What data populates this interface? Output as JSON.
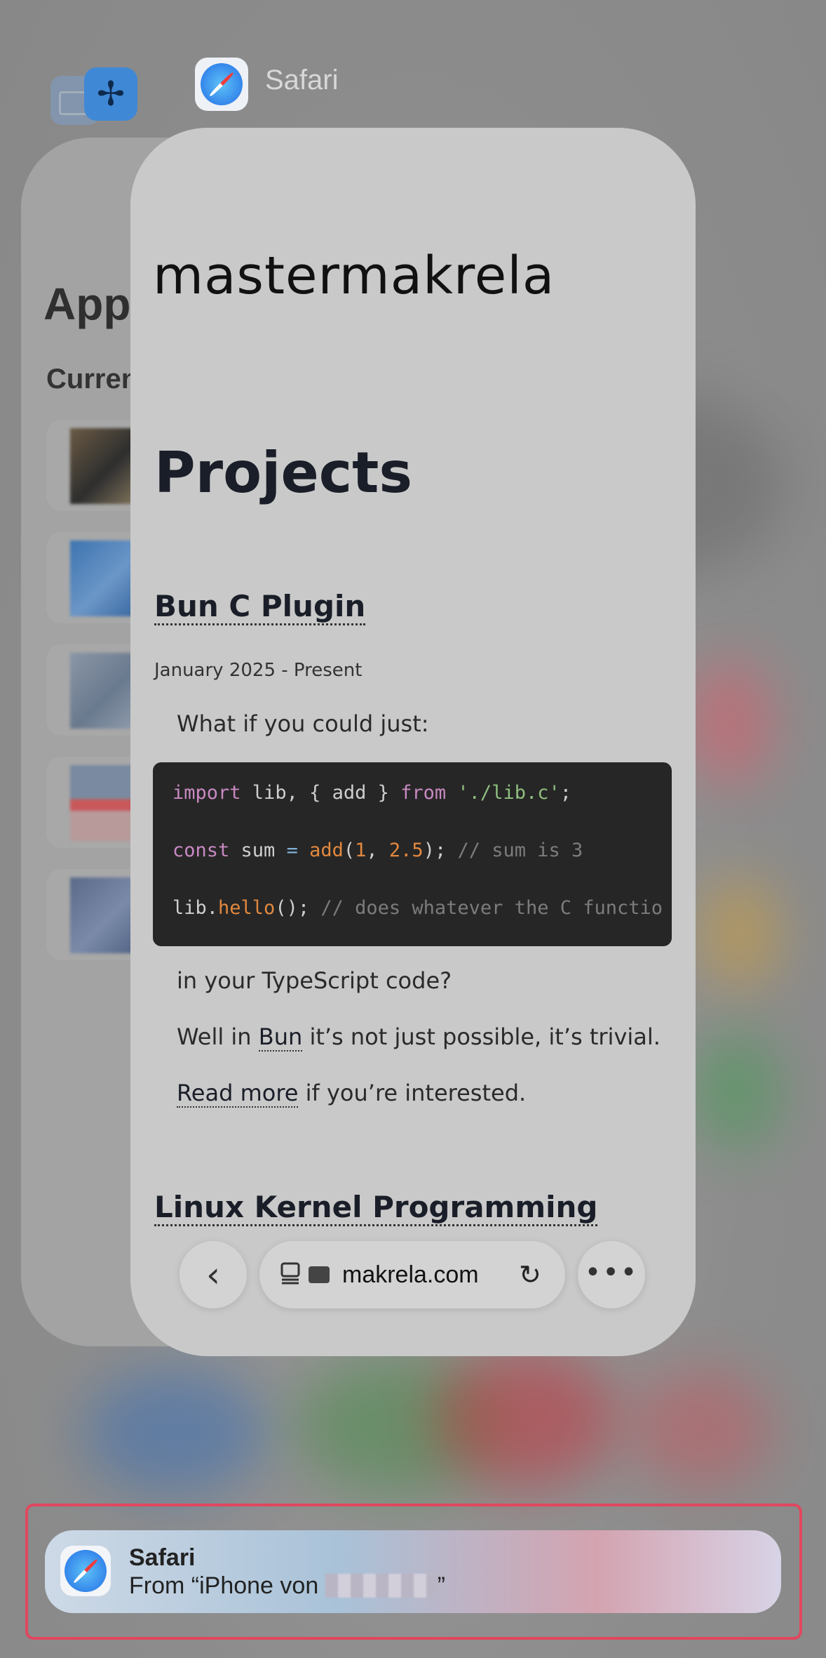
{
  "switcher": {
    "top_app_label": "Safari",
    "top_app_icon": "safari-compass-icon",
    "bg_app_icons": [
      "mail-icon",
      "propeller-icon"
    ]
  },
  "background_card": {
    "title": "App",
    "subtitle": "Curren"
  },
  "page": {
    "brand": "mastermakrela",
    "heading": "Projects",
    "project": {
      "title": "Bun C Plugin",
      "date": "January 2025 - Present",
      "intro": "What if you could just:",
      "code_lines": [
        "import lib, { add } from './lib.c';",
        "const sum = add(1, 2.5); // sum is 3",
        "lib.hello(); // does whatever the C functio"
      ],
      "after_code": "in your TypeScript code?",
      "well_prefix": "Well in ",
      "well_link": "Bun",
      "well_suffix": " it’s not just possible, it’s trivial.",
      "read_more_link": "Read more",
      "read_more_suffix": " if you’re interested."
    },
    "next_project_title": "Linux Kernel Programming"
  },
  "toolbar": {
    "back_icon": "chevron-left-icon",
    "url": "makrela.com",
    "reload_icon": "reload-icon",
    "more_icon": "ellipsis-icon"
  },
  "handoff": {
    "app": "Safari",
    "from_prefix": "From “iPhone von ",
    "from_suffix": "”"
  },
  "colors": {
    "accent_red_border": "#e0475e",
    "code_bg": "#262626",
    "keyword": "#c889c2",
    "string": "#8fbf7f",
    "function": "#e2883f",
    "comment": "#7c7c7c"
  }
}
